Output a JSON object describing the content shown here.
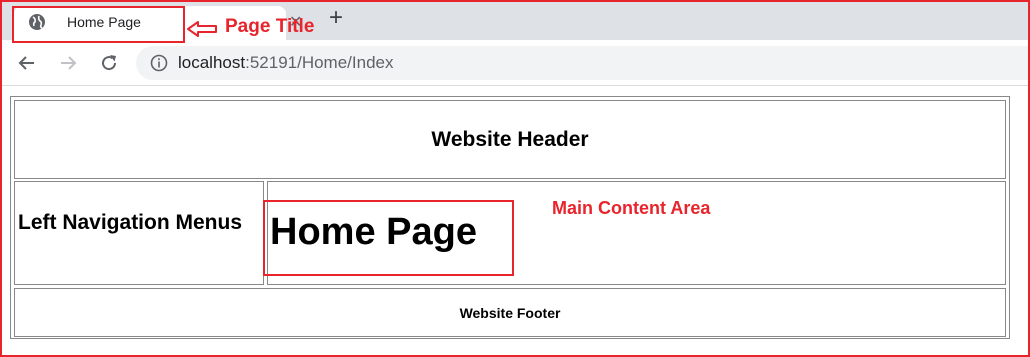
{
  "browser": {
    "tab": {
      "title": "Home Page",
      "close_glyph": "✕"
    },
    "new_tab_glyph": "+",
    "address": {
      "host": "localhost",
      "rest": ":52191/Home/Index"
    },
    "icons": {
      "tab": "globe-icon",
      "back": "back-arrow-icon",
      "forward": "forward-arrow-icon",
      "reload": "reload-icon",
      "info": "info-icon"
    }
  },
  "page": {
    "header": "Website Header",
    "nav": "Left Navigation Menus",
    "main_heading": "Home Page",
    "footer": "Website Footer"
  },
  "annotations": {
    "page_title": "Page Title",
    "main_content": "Main Content Area",
    "color": "#e8242c"
  }
}
